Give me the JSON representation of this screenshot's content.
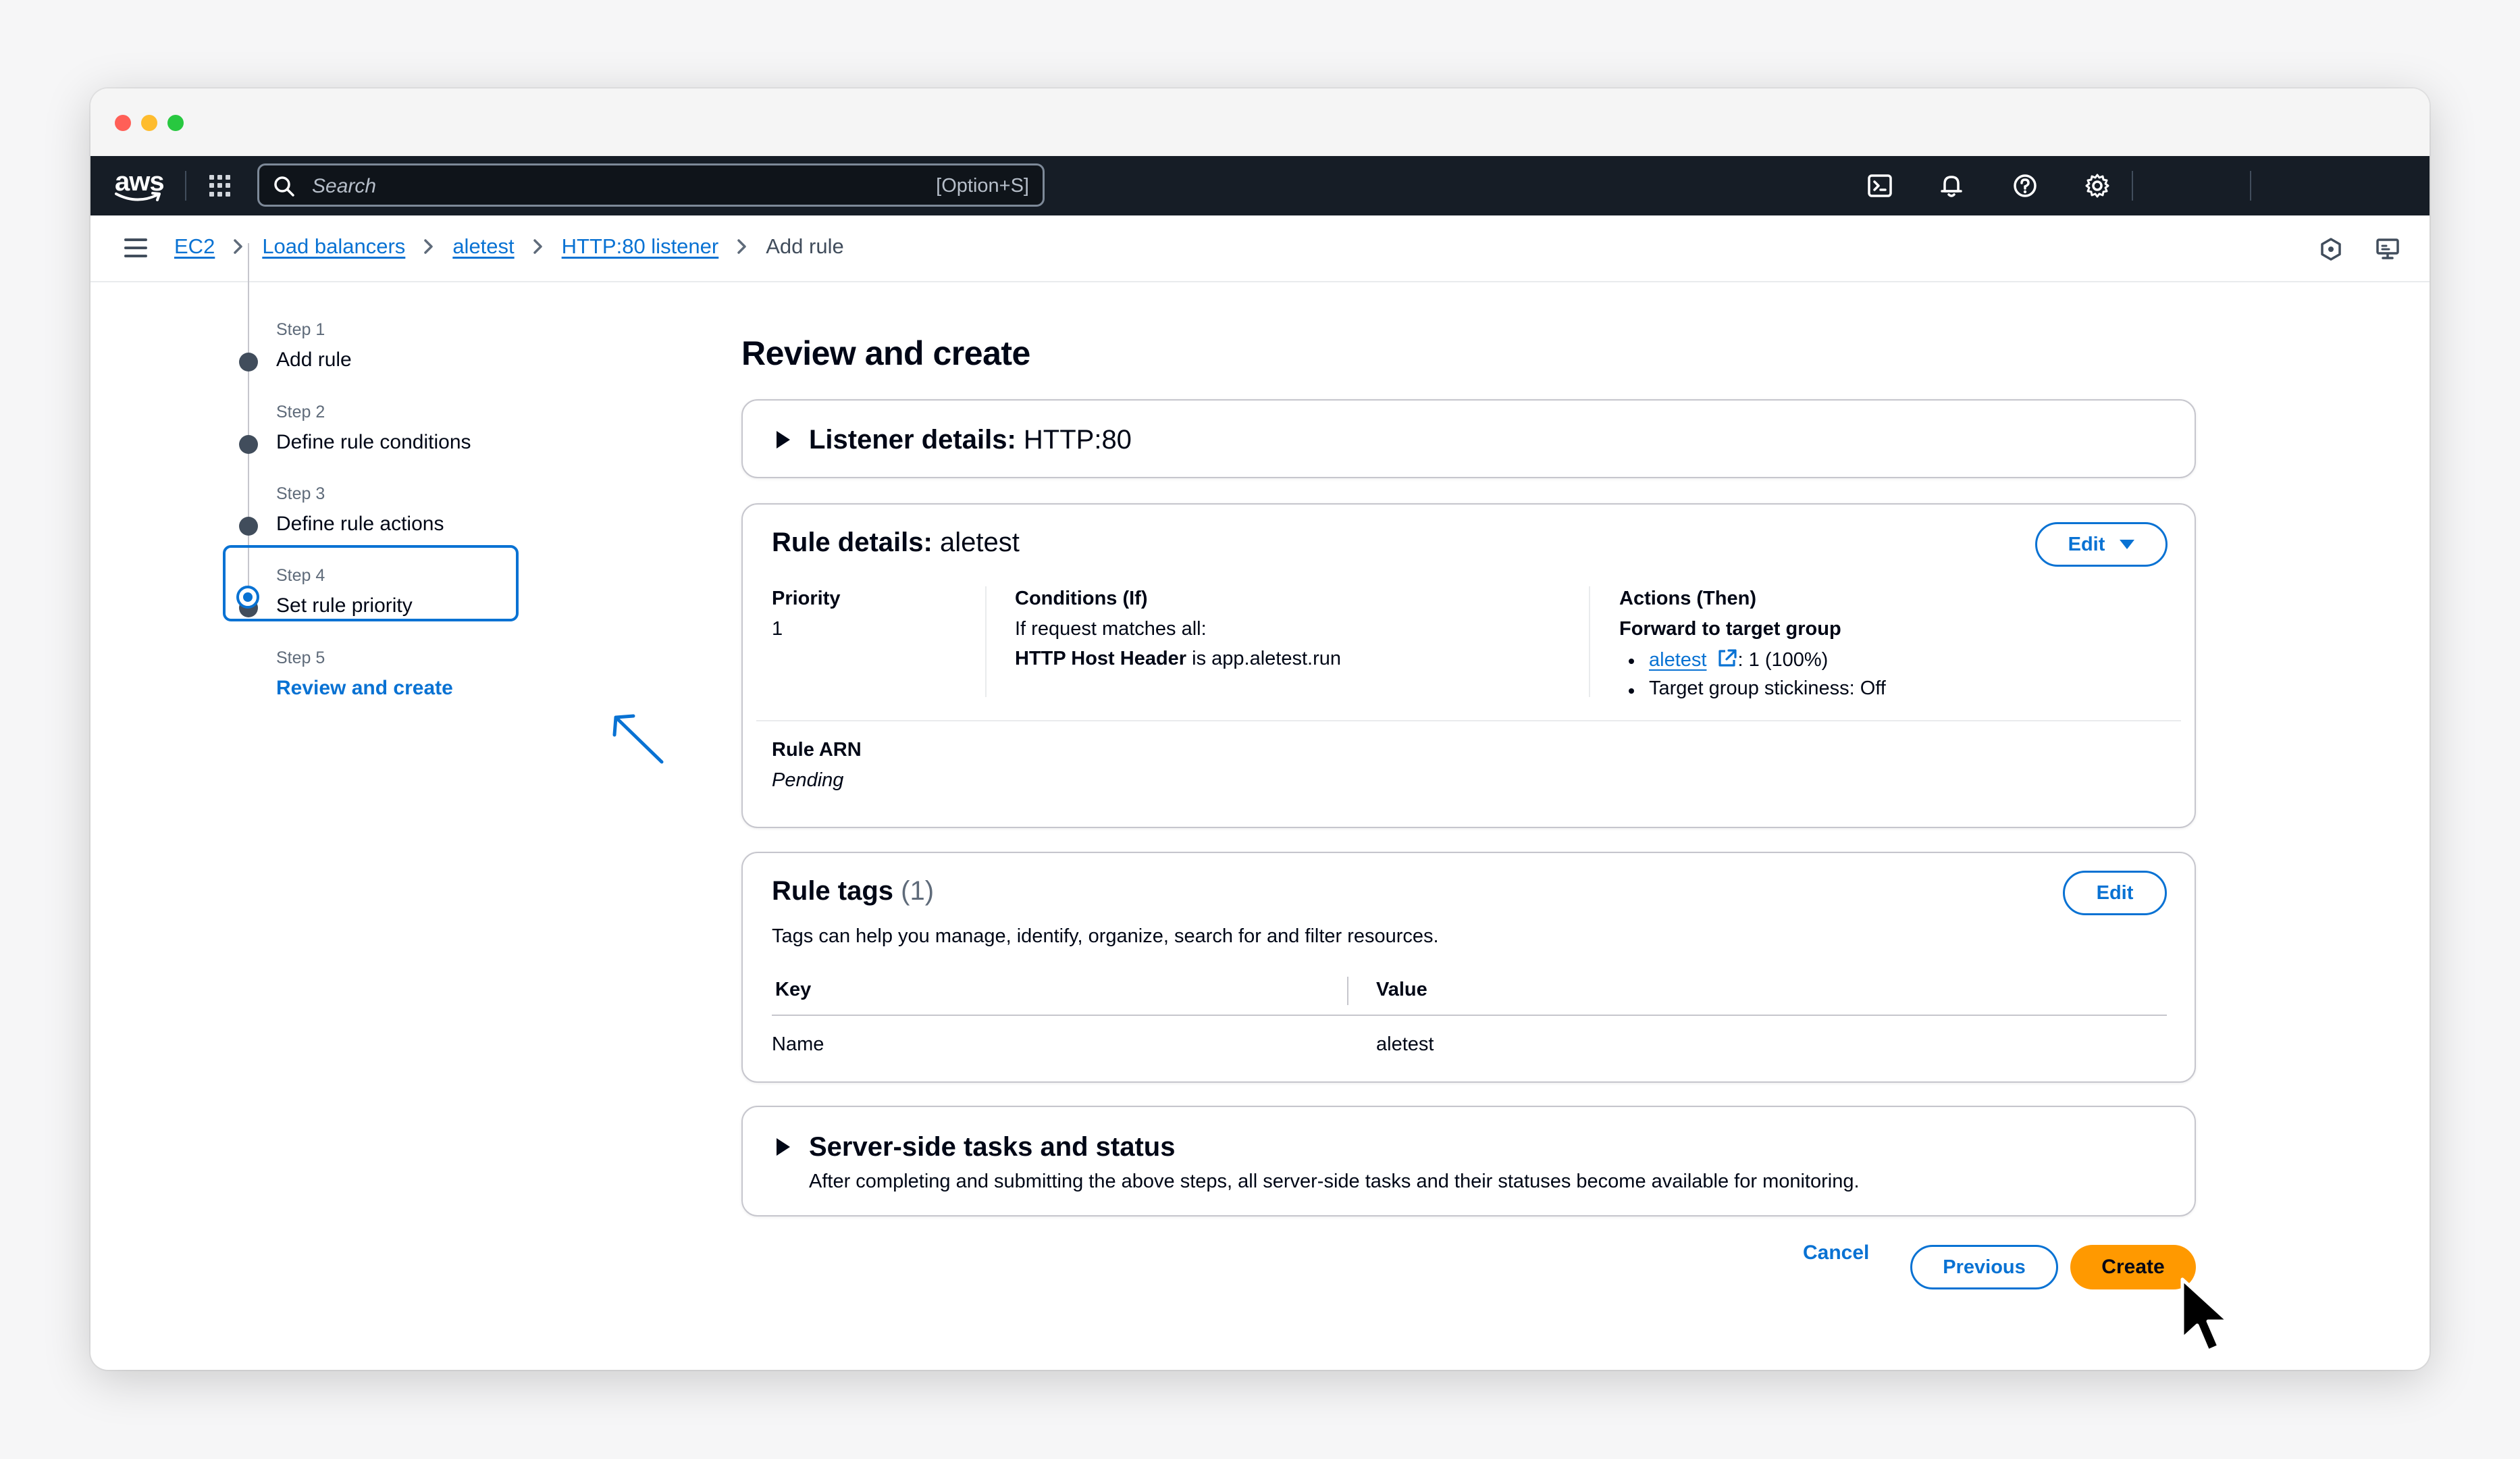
{
  "topnav": {
    "logo": "aws",
    "search_placeholder": "Search",
    "search_shortcut": "[Option+S]"
  },
  "breadcrumb": {
    "items": [
      "EC2",
      "Load balancers",
      "aletest",
      "HTTP:80 listener"
    ],
    "current": "Add rule"
  },
  "steps": [
    {
      "label": "Step 1",
      "title": "Add rule"
    },
    {
      "label": "Step 2",
      "title": "Define rule conditions"
    },
    {
      "label": "Step 3",
      "title": "Define rule actions"
    },
    {
      "label": "Step 4",
      "title": "Set rule priority"
    },
    {
      "label": "Step 5",
      "title": "Review and create"
    }
  ],
  "page": {
    "title": "Review and create"
  },
  "listener": {
    "heading": "Listener details:",
    "value": "HTTP:80"
  },
  "rule": {
    "heading": "Rule details:",
    "value": "aletest",
    "edit_label": "Edit",
    "priority_label": "Priority",
    "priority_value": "1",
    "conditions_label": "Conditions (If)",
    "conditions_line1": "If request matches all:",
    "conditions_key": "HTTP Host Header",
    "conditions_rest": " is app.aletest.run",
    "actions_label": "Actions (Then)",
    "actions_line1": "Forward to target group",
    "target_link": "aletest",
    "target_weight": ": 1 (100%)",
    "stickiness": "Target group stickiness: Off",
    "arn_label": "Rule ARN",
    "arn_value": "Pending"
  },
  "tags": {
    "heading": "Rule tags",
    "count": "(1)",
    "edit_label": "Edit",
    "description": "Tags can help you manage, identify, organize, search for and filter resources.",
    "col_key": "Key",
    "col_value": "Value",
    "rows": [
      {
        "key": "Name",
        "value": "aletest"
      }
    ]
  },
  "server": {
    "heading": "Server-side tasks and status",
    "description": "After completing and submitting the above steps, all server-side tasks and their statuses become available for monitoring."
  },
  "actions": {
    "cancel": "Cancel",
    "previous": "Previous",
    "create": "Create"
  },
  "colors": {
    "accent": "#0972d3",
    "primary_button": "#ff9900",
    "nav_bg": "#161d26"
  }
}
